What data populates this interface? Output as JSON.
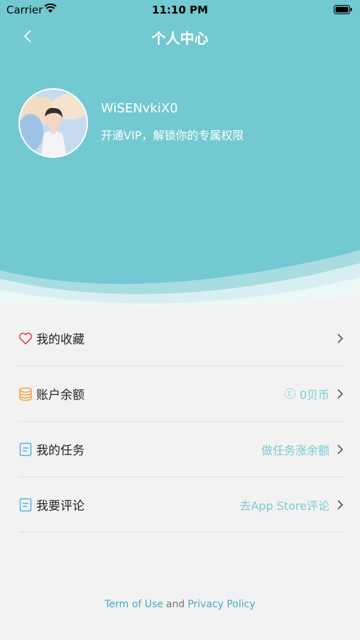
{
  "status_bar": {
    "carrier": "Carrier",
    "time": "11:10 PM"
  },
  "header": {
    "title": "个人中心",
    "username": "WiSENvkiX0",
    "vip_prompt": "开通VIP，解锁你的专属权限",
    "background_color": "#72c9d1"
  },
  "menu": {
    "items": [
      {
        "label": "我的收藏",
        "value": "",
        "icon": "heart-icon"
      },
      {
        "label": "账户余额",
        "value": "0贝币",
        "icon": "coins-icon",
        "value_icon": "coin-icon",
        "value_icon_glyph": "E"
      },
      {
        "label": "我的任务",
        "value": "做任务涨余额",
        "icon": "document-icon"
      },
      {
        "label": "我要评论",
        "value": "去App Store评论",
        "icon": "document-icon"
      }
    ]
  },
  "footer": {
    "terms": "Term of Use",
    "and": "and",
    "privacy": "Privacy Policy"
  },
  "colors": {
    "accent": "#7cc9d1",
    "link": "#4aa8c6",
    "heart": "#e0484f",
    "coins": "#f2a246",
    "document": "#5aaee0"
  }
}
